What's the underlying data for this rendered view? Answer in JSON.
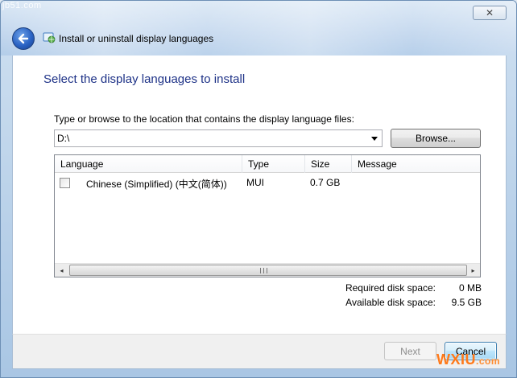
{
  "watermark_top": "jb51.com",
  "window": {
    "title": "Install or uninstall display languages",
    "close_glyph": "✕"
  },
  "page": {
    "heading": "Select the display languages to install",
    "prompt": "Type or browse to the location that contains the display language files:",
    "path_value": "D:\\",
    "browse_label": "Browse..."
  },
  "list": {
    "columns": [
      "Language",
      "Type",
      "Size",
      "Message"
    ],
    "rows": [
      {
        "checked": false,
        "language": "Chinese (Simplified) (中文(简体))",
        "type": "MUI",
        "size": "0.7 GB",
        "message": ""
      }
    ],
    "scroll_left": "◂",
    "scroll_right": "▸"
  },
  "disk": {
    "required_label": "Required disk space:",
    "required_value": "0 MB",
    "available_label": "Available disk space:",
    "available_value": "9.5 GB"
  },
  "footer": {
    "next_label": "Next",
    "cancel_label": "Cancel"
  },
  "watermark_bottom": {
    "main": "WXIU",
    "suffix": ".com"
  },
  "icons": {
    "back": "back-arrow-icon",
    "window": "language-globe-icon",
    "dropdown": "chevron-down-icon"
  }
}
